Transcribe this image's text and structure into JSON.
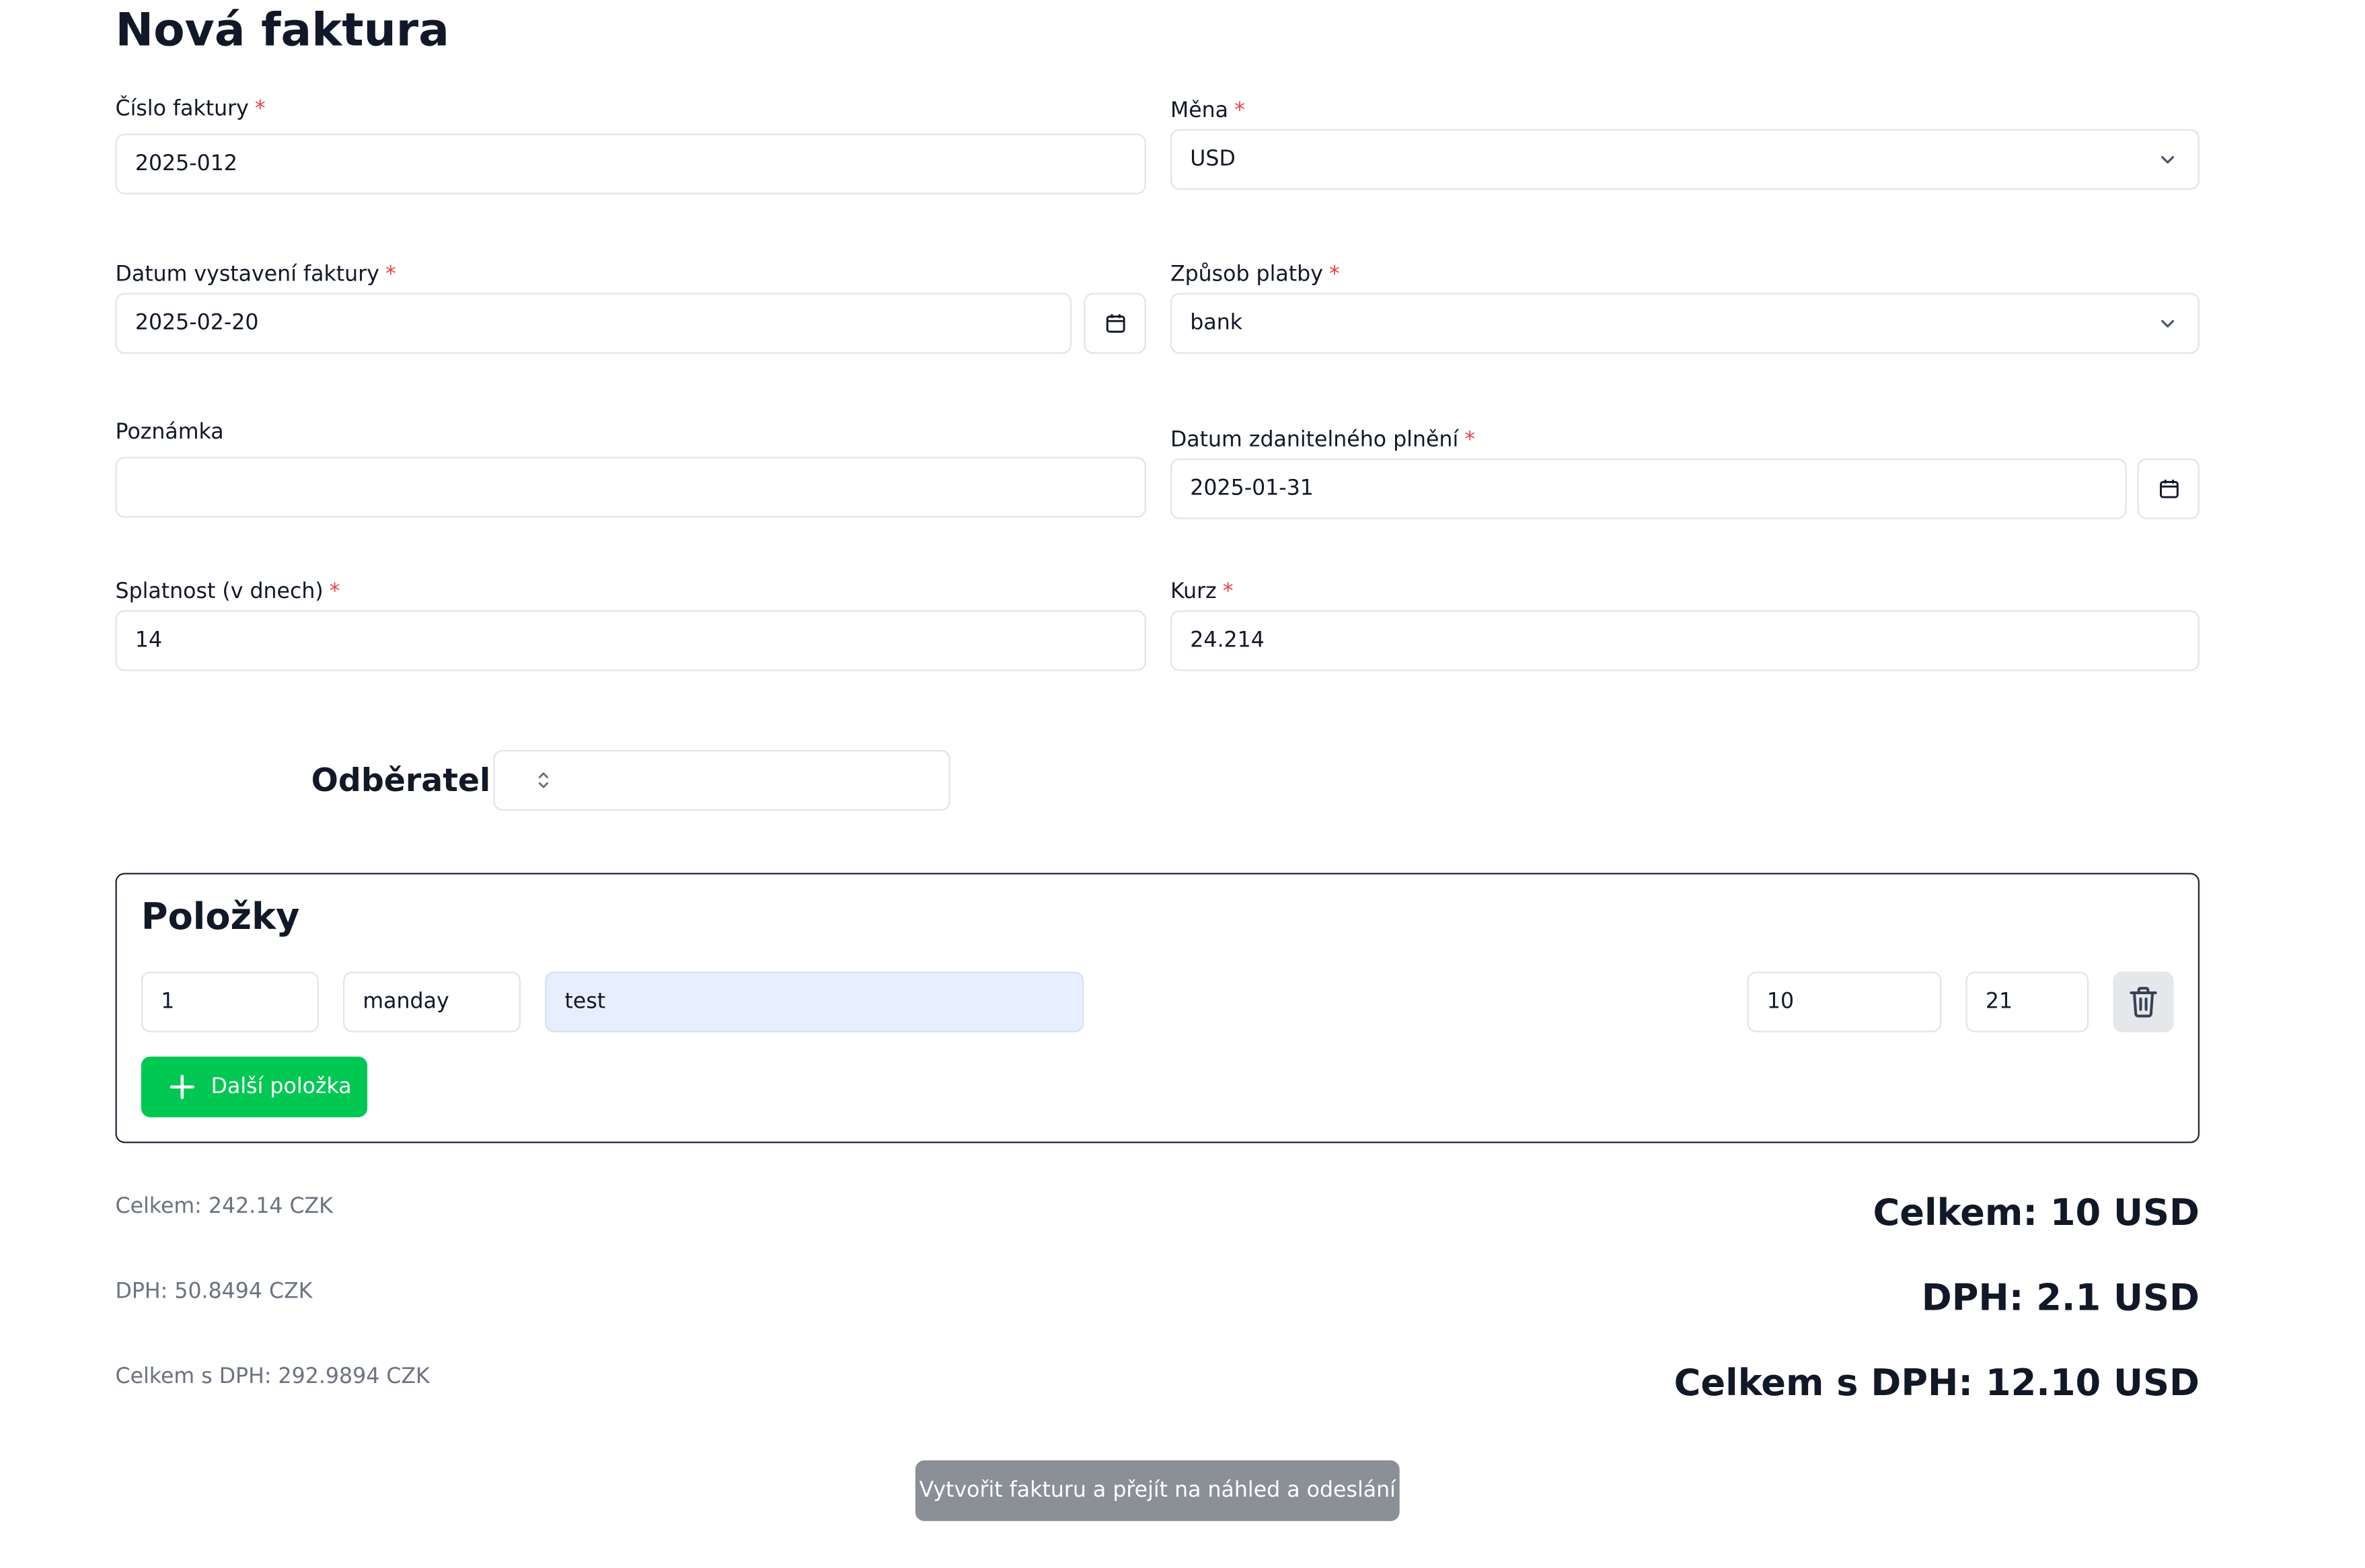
{
  "page": {
    "title": "Nová faktura"
  },
  "form": {
    "invoice_number": {
      "label": "Číslo faktury",
      "required": "*",
      "value": "2025-012"
    },
    "currency": {
      "label": "Měna",
      "required": "*",
      "value": "USD"
    },
    "issue_date": {
      "label": "Datum vystavení faktury",
      "required": "*",
      "value": "2025-02-20"
    },
    "payment_method": {
      "label": "Způsob platby",
      "required": "*",
      "value": "bank"
    },
    "note": {
      "label": "Poznámka",
      "value": ""
    },
    "taxable_date": {
      "label": "Datum zdanitelného plnění",
      "required": "*",
      "value": "2025-01-31"
    },
    "due_days": {
      "label": "Splatnost (v dnech)",
      "required": "*",
      "value": "14"
    },
    "rate": {
      "label": "Kurz",
      "required": "*",
      "value": "24.214"
    }
  },
  "customer": {
    "label": "Odběratel",
    "value": ""
  },
  "items": {
    "title": "Položky",
    "rows": [
      {
        "quantity": "1",
        "unit": "manday",
        "description": "test",
        "price": "10",
        "vat": "21"
      }
    ],
    "add_label": "Další položka"
  },
  "totals": {
    "czk": {
      "total": "Celkem: 242.14 CZK",
      "vat": "DPH: 50.8494 CZK",
      "total_with_vat": "Celkem s DPH: 292.9894 CZK"
    },
    "usd": {
      "total": "Celkem: 10 USD",
      "vat": "DPH: 2.1 USD",
      "total_with_vat": "Celkem s DPH: 12.10 USD"
    }
  },
  "submit_label": "Vytvořit fakturu a přejít na náhled a odeslání",
  "icons": {
    "calendar": "calendar-icon",
    "chevron": "chevron-down-icon",
    "updown": "chevrons-up-down-icon",
    "trash": "trash-icon",
    "plus": "plus-icon"
  },
  "colors": {
    "accent": "#00c853",
    "required": "#ef4444",
    "submit_disabled": "#8b8f96",
    "highlight_input": "#e8effc"
  }
}
